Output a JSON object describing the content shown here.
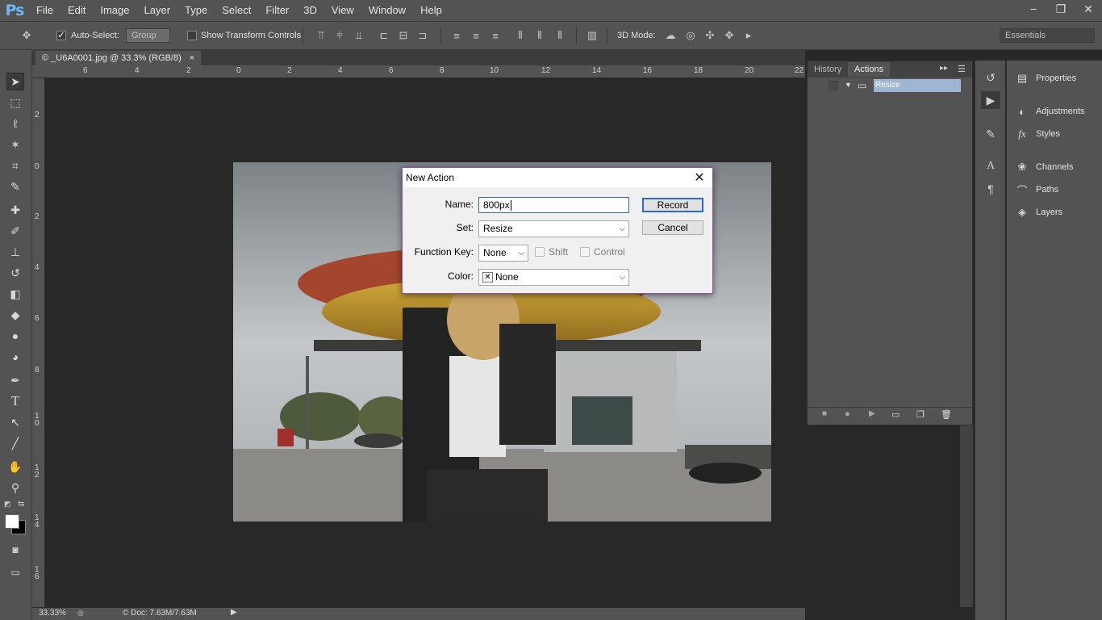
{
  "app": {
    "logo": "Ps"
  },
  "menu": [
    "File",
    "Edit",
    "Image",
    "Layer",
    "Type",
    "Select",
    "Filter",
    "3D",
    "View",
    "Window",
    "Help"
  ],
  "window_controls": {
    "minimize": "−",
    "restore": "❐",
    "close": "✕"
  },
  "options_bar": {
    "auto_select_label": "Auto-Select:",
    "auto_select_checked": true,
    "auto_select_value": "Group",
    "show_transform_label": "Show Transform Controls",
    "show_transform_checked": false,
    "mode_3d_label": "3D Mode:",
    "workspace": "Essentials"
  },
  "document": {
    "tab_title": "© _U6A0001.jpg @ 33.3% (RGB/8)",
    "tab_close": "×",
    "zoom": "33.33%",
    "doc_info": "© Doc: 7.63M/7.63M"
  },
  "ruler_top_labels": [
    "6",
    "4",
    "2",
    "0",
    "2",
    "4",
    "6",
    "8",
    "10",
    "12",
    "14",
    "16",
    "18",
    "20",
    "22"
  ],
  "ruler_left_labels": [
    "2",
    "0",
    "2",
    "4",
    "6",
    "8",
    "1\n0",
    "1\n2",
    "1\n4",
    "1\n6"
  ],
  "actions_panel": {
    "tabs": [
      "History",
      "Actions"
    ],
    "active_tab": "Actions",
    "set_name": "Resize"
  },
  "right_panels": [
    {
      "label": "Properties",
      "icon": "properties-icon"
    },
    {
      "label": "Adjustments",
      "icon": "adjustments-icon"
    },
    {
      "label": "Styles",
      "icon": "styles-icon"
    },
    {
      "label": "Channels",
      "icon": "channels-icon"
    },
    {
      "label": "Paths",
      "icon": "paths-icon"
    },
    {
      "label": "Layers",
      "icon": "layers-icon"
    }
  ],
  "dialog": {
    "title": "New Action",
    "name_label": "Name:",
    "name_value": "800px",
    "set_label": "Set:",
    "set_value": "Resize",
    "function_key_label": "Function Key:",
    "function_key_value": "None",
    "shift_label": "Shift",
    "control_label": "Control",
    "color_label": "Color:",
    "color_value": "None",
    "record_button": "Record",
    "cancel_button": "Cancel"
  },
  "colors": {
    "ui_bg": "#535353",
    "canvas_bg": "#282828",
    "dialog_border": "#8e52a3",
    "focus_blue": "#2a6bd1",
    "ps_blue": "#6fb6f5"
  }
}
